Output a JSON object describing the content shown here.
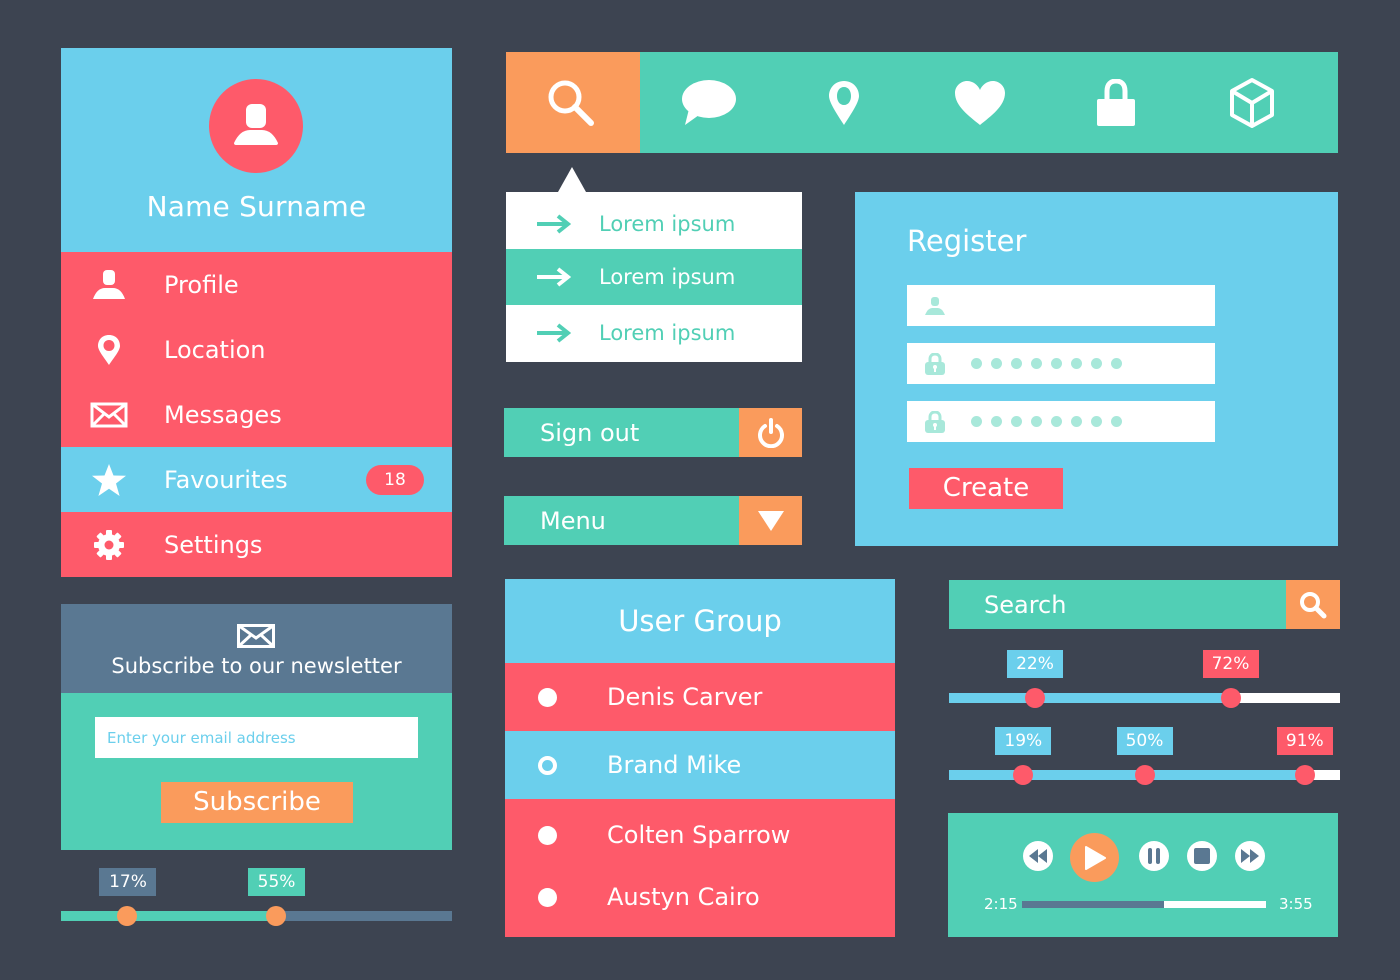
{
  "colors": {
    "background": "#3d4451",
    "blue": "#6bcfec",
    "red": "#fe5a6a",
    "teal": "#51cfb5",
    "orange": "#fa9b5c",
    "slate": "#5a7892",
    "white": "#ffffff"
  },
  "profile": {
    "name": "Name Surname",
    "avatar_icon": "user-icon",
    "menu": [
      {
        "label": "Profile",
        "icon": "user-icon",
        "active": false
      },
      {
        "label": "Location",
        "icon": "map-pin-icon",
        "active": false
      },
      {
        "label": "Messages",
        "icon": "envelope-icon",
        "active": false
      },
      {
        "label": "Favourites",
        "icon": "star-icon",
        "active": true,
        "badge": "18"
      },
      {
        "label": "Settings",
        "icon": "gear-icon",
        "active": false
      }
    ]
  },
  "newsletter": {
    "icon": "envelope-icon",
    "title": "Subscribe to our newsletter",
    "email_placeholder": "Enter your email address",
    "email_value": "",
    "subscribe_label": "Subscribe"
  },
  "range_slider_left": {
    "values": [
      17,
      55
    ],
    "labels": [
      "17%",
      "55%"
    ]
  },
  "toolbar": {
    "items": [
      {
        "icon": "search-icon",
        "active": true
      },
      {
        "icon": "chat-bubble-icon",
        "active": false
      },
      {
        "icon": "map-pin-icon",
        "active": false
      },
      {
        "icon": "heart-icon",
        "active": false
      },
      {
        "icon": "lock-icon",
        "active": false
      },
      {
        "icon": "cube-icon",
        "active": false
      }
    ]
  },
  "dropdown": {
    "items": [
      {
        "label": "Lorem ipsum",
        "icon": "arrow-right-icon",
        "active": false
      },
      {
        "label": "Lorem ipsum",
        "icon": "arrow-right-icon",
        "active": true
      },
      {
        "label": "Lorem ipsum",
        "icon": "arrow-right-icon",
        "active": false
      }
    ]
  },
  "buttons": {
    "sign_out_label": "Sign out",
    "sign_out_icon": "power-icon",
    "menu_label": "Menu",
    "menu_icon": "caret-down-icon"
  },
  "register": {
    "title": "Register",
    "username_value": "",
    "password_mask_length": 8,
    "confirm_mask_length": 8,
    "create_label": "Create"
  },
  "user_group": {
    "title": "User Group",
    "users": [
      {
        "name": "Denis Carver",
        "selected": false
      },
      {
        "name": "Brand Mike",
        "selected": true
      },
      {
        "name": "Colten Sparrow",
        "selected": false
      },
      {
        "name": "Austyn Cairo",
        "selected": false
      }
    ]
  },
  "search": {
    "placeholder": "Search",
    "value": ""
  },
  "range_slider_right_1": {
    "values": [
      22,
      72
    ],
    "labels": [
      "22%",
      "72%"
    ]
  },
  "range_slider_right_2": {
    "values": [
      19,
      50,
      91
    ],
    "labels": [
      "19%",
      "50%",
      "91%"
    ]
  },
  "player": {
    "current_time": "2:15",
    "total_time": "3:55",
    "progress_percent": 58
  }
}
